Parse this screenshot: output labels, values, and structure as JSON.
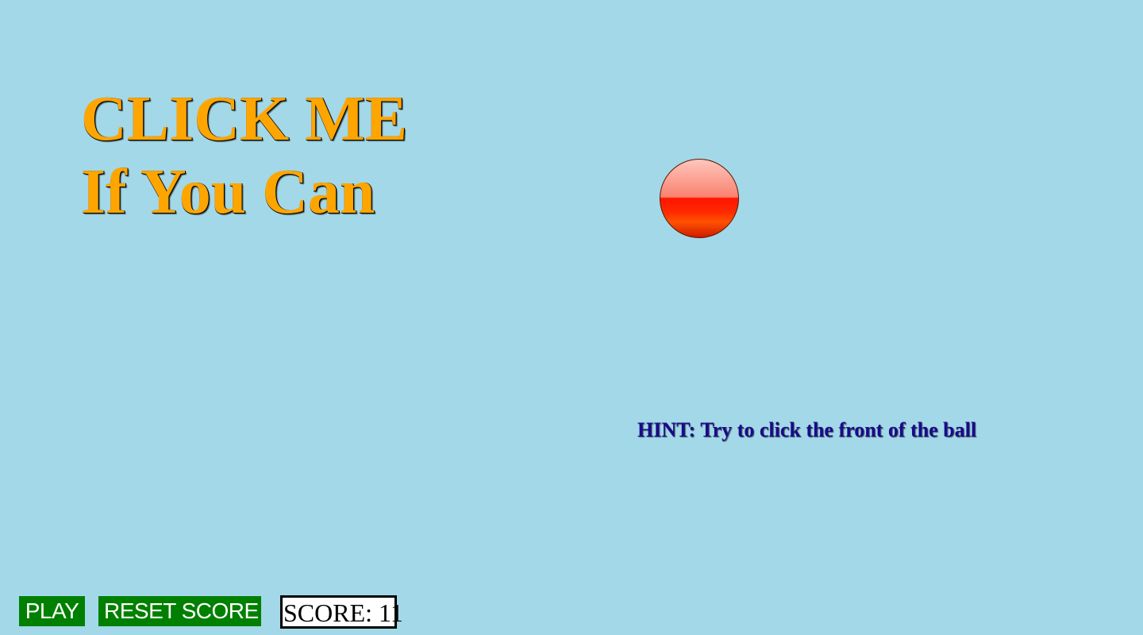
{
  "title": {
    "line1": "CLICK ME",
    "line2": "If You Can"
  },
  "hint": "HINT: Try to click the front of the ball",
  "controls": {
    "play_label": "PLAY",
    "reset_label": "RESET SCORE",
    "score_text": "SCORE: 11"
  },
  "colors": {
    "background": "#a3d8e8",
    "title": "#ffa500",
    "hint": "#1a0a8a",
    "button": "#008000",
    "ball": "#ff1400"
  }
}
